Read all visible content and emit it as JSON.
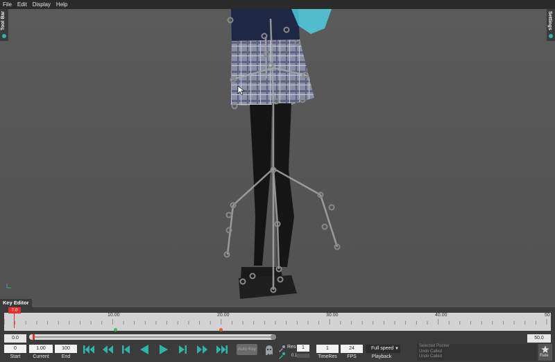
{
  "menu": [
    "File",
    "Edit",
    "Display",
    "Help"
  ],
  "panels": {
    "left_tab": "Tool Bar",
    "right_tab": "Settings",
    "bottom_tab": "Key Editor"
  },
  "ruler": {
    "marker": "7.0",
    "labels": [
      "10.00",
      "20.00",
      "30.00",
      "40.00",
      "50"
    ],
    "min": 0,
    "max": 50,
    "current": 7
  },
  "range": {
    "left_value": "0.0",
    "right_value": "50.0"
  },
  "fields": {
    "start": {
      "value": "0",
      "label": "Start"
    },
    "current": {
      "value": "1.00",
      "label": "Current"
    },
    "end": {
      "value": "100",
      "label": "End"
    }
  },
  "auto_key": "Auto Key",
  "res": {
    "label": "Res",
    "value": "1",
    "value2": "0.1"
  },
  "timeres": {
    "value": "1",
    "label": "TimeRes"
  },
  "fps": {
    "value": "24",
    "label": "FPS"
  },
  "playback": {
    "value": "Full speed",
    "label": "Playback"
  },
  "log_lines": [
    "Selected Pointer",
    "Undo Called",
    "Undo Called"
  ],
  "rate_label": "Rate",
  "colors": {
    "accent": "#2fb5a6",
    "marker": "#e23030",
    "panel": "#3b3b3b"
  },
  "icons": [
    "skip-start-icon",
    "rewind-icon",
    "step-back-icon",
    "play-reverse-icon",
    "play-icon",
    "step-forward-icon",
    "fast-forward-icon",
    "skip-end-icon",
    "ghost-icon",
    "eyedropper-icon",
    "star-icon"
  ]
}
